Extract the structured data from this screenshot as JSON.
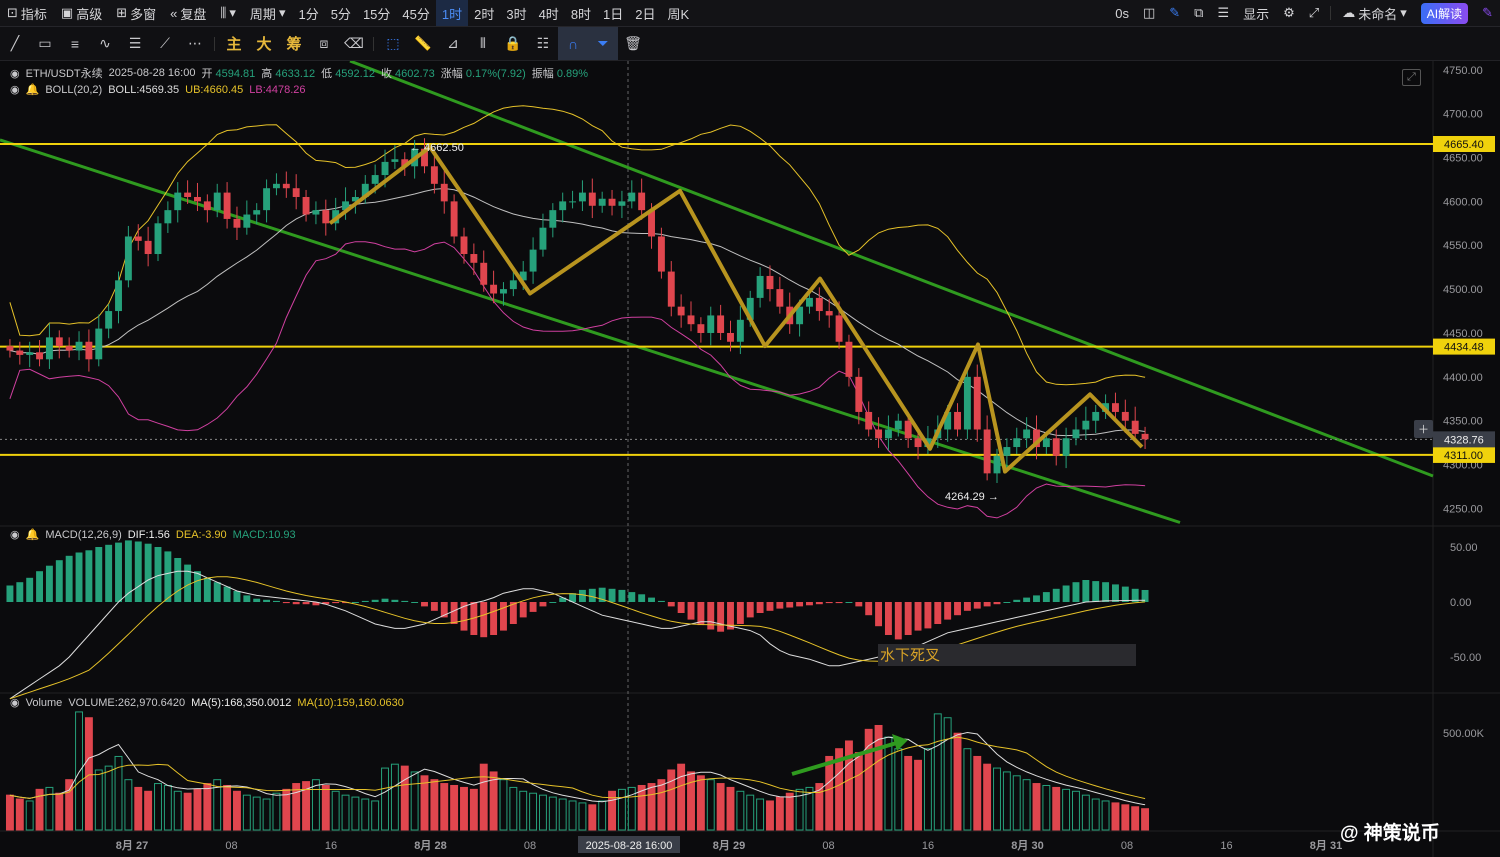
{
  "topbar": {
    "indicators": "指标",
    "advanced": "高级",
    "multi_window": "多窗",
    "replay": "复盘",
    "period": "周期",
    "timeframes": [
      "1分",
      "5分",
      "15分",
      "45分",
      "1时",
      "2时",
      "3时",
      "4时",
      "8时",
      "1日",
      "2日",
      "周K"
    ],
    "active_timeframe": "1时",
    "countdown": "0s",
    "display": "显示",
    "unnamed": "未命名",
    "ai_explain": "AI解读"
  },
  "drawing_tools": {
    "main": "主",
    "big": "大",
    "chip": "筹"
  },
  "price_legend": {
    "symbol": "ETH/USDT永续",
    "datetime": "2025-08-28 16:00",
    "open_label": "开",
    "open": "4594.81",
    "high_label": "高",
    "high": "4633.12",
    "low_label": "低",
    "low": "4592.12",
    "close_label": "收",
    "close": "4602.73",
    "change_label": "涨幅",
    "change": "0.17%(7.92)",
    "amplitude_label": "振幅",
    "amplitude": "0.89%"
  },
  "boll_legend": {
    "name": "BOLL(20,2)",
    "boll": "BOLL:4569.35",
    "ub": "UB:4660.45",
    "lb": "LB:4478.26"
  },
  "macd_legend": {
    "name": "MACD(12,26,9)",
    "dif": "DIF:1.56",
    "dea": "DEA:-3.90",
    "macd": "MACD:10.93"
  },
  "volume_legend": {
    "name": "Volume",
    "volume": "VOLUME:262,970.6420",
    "ma5": "MA(5):168,350.0012",
    "ma10": "MA(10):159,160.0630"
  },
  "annotations": {
    "high_marker": "4662.50",
    "low_marker": "4264.29",
    "macd_note": "水下死叉",
    "crosshair_time": "2025-08-28 16:00"
  },
  "price_tags": {
    "resistance_top": "4665.40",
    "resistance_mid": "4434.48",
    "current": "4328.76",
    "support": "4311.00"
  },
  "price_axis_labels": [
    "4750.00",
    "4700.00",
    "4650.00",
    "4600.00",
    "4550.00",
    "4500.00",
    "4450.00",
    "4400.00",
    "4350.00",
    "4300.00",
    "4250.00"
  ],
  "macd_axis_labels": [
    "50.00",
    "0.00",
    "-50.00"
  ],
  "volume_axis_labels": [
    "500.00K"
  ],
  "time_axis_labels": [
    "8月 27",
    "08",
    "16",
    "8月 28",
    "08",
    "16",
    "8月 29",
    "08",
    "16",
    "8月 30",
    "08",
    "16",
    "8月 31"
  ],
  "watermark": "@ 神策说币",
  "colors": {
    "up": "#26a17b",
    "down": "#e0464e",
    "level_line": "#f0d20c",
    "channel": "#2f9a1f",
    "zigzag": "#b8941f",
    "boll_mid": "#c0c0c0",
    "boll_up": "#e6c229",
    "boll_low": "#d040a0",
    "accent": "#3b7ef5"
  },
  "chart_data": {
    "type": "candlestick",
    "symbol": "ETH/USDT",
    "ylim": [
      4230,
      4760
    ],
    "levels": [
      4665.4,
      4434.48,
      4311.0
    ],
    "current_price": 4328.76,
    "closes": [
      4430,
      4425,
      4428,
      4420,
      4445,
      4435,
      4430,
      4440,
      4420,
      4455,
      4475,
      4510,
      4560,
      4555,
      4540,
      4575,
      4590,
      4610,
      4605,
      4600,
      4590,
      4610,
      4580,
      4570,
      4585,
      4590,
      4615,
      4620,
      4615,
      4605,
      4585,
      4590,
      4575,
      4590,
      4600,
      4605,
      4620,
      4630,
      4645,
      4648,
      4640,
      4660,
      4640,
      4620,
      4600,
      4560,
      4540,
      4530,
      4505,
      4495,
      4500,
      4510,
      4520,
      4545,
      4570,
      4590,
      4600,
      4600,
      4610,
      4595,
      4603,
      4595,
      4600,
      4610,
      4590,
      4560,
      4520,
      4480,
      4470,
      4460,
      4450,
      4470,
      4450,
      4440,
      4465,
      4490,
      4515,
      4500,
      4480,
      4460,
      4480,
      4490,
      4475,
      4470,
      4440,
      4400,
      4360,
      4340,
      4330,
      4340,
      4350,
      4330,
      4320,
      4330,
      4340,
      4360,
      4340,
      4400,
      4340,
      4290,
      4310,
      4320,
      4330,
      4340,
      4320,
      4330,
      4310,
      4330,
      4340,
      4350,
      4360,
      4370,
      4360,
      4350,
      4335,
      4328.76
    ],
    "macd_hist": [
      15,
      18,
      22,
      28,
      33,
      38,
      42,
      45,
      47,
      50,
      52,
      54,
      56,
      55,
      53,
      50,
      46,
      40,
      34,
      28,
      22,
      18,
      14,
      10,
      6,
      3,
      2,
      1,
      -1,
      -2,
      -2,
      -3,
      -2,
      -1,
      -1,
      0,
      1,
      2,
      3,
      2,
      1,
      0,
      -4,
      -8,
      -14,
      -20,
      -26,
      -30,
      -32,
      -30,
      -26,
      -20,
      -14,
      -9,
      -4,
      0,
      4,
      8,
      11,
      12,
      13,
      12,
      11,
      9,
      7,
      4,
      1,
      -4,
      -10,
      -16,
      -21,
      -25,
      -27,
      -25,
      -20,
      -14,
      -10,
      -8,
      -6,
      -5,
      -4,
      -3,
      -2,
      -1,
      -1,
      0,
      -4,
      -12,
      -22,
      -30,
      -34,
      -30,
      -26,
      -24,
      -20,
      -16,
      -12,
      -8,
      -6,
      -4,
      -2,
      0,
      2,
      4,
      6,
      9,
      12,
      15,
      18,
      20,
      19,
      18,
      16,
      14,
      12,
      10.93
    ],
    "dif": [
      -88,
      -82,
      -76,
      -70,
      -64,
      -58,
      -50,
      -40,
      -30,
      -20,
      -10,
      0,
      8,
      14,
      20,
      24,
      26,
      28,
      28,
      26,
      22,
      18,
      14,
      10,
      8,
      6,
      5,
      4,
      3,
      2,
      1,
      0,
      -2,
      -5,
      -8,
      -12,
      -16,
      -20,
      -22,
      -24,
      -24,
      -22,
      -20,
      -16,
      -12,
      -8,
      -4,
      -1,
      1,
      4,
      8,
      10,
      12,
      12,
      10,
      8,
      4,
      0,
      -4,
      -8,
      -12,
      -14,
      -16,
      -18,
      -20,
      -22,
      -24,
      -24,
      -22,
      -20,
      -18,
      -18,
      -20,
      -22,
      -24,
      -26,
      -30,
      -38,
      -44,
      -48,
      -50,
      -52,
      -55,
      -58,
      -58,
      -56,
      -54,
      -52,
      -50,
      -48,
      -46,
      -44,
      -40,
      -36,
      -32,
      -28,
      -26,
      -24,
      -22,
      -20,
      -18,
      -16,
      -14,
      -12,
      -10,
      -8,
      -6,
      -4,
      -2,
      0,
      0.5,
      1,
      1.2,
      1.4,
      1.5,
      1.56
    ],
    "volume": [
      180,
      160,
      150,
      210,
      220,
      190,
      260,
      610,
      580,
      310,
      330,
      380,
      260,
      220,
      200,
      240,
      230,
      200,
      190,
      210,
      240,
      260,
      230,
      200,
      180,
      170,
      160,
      190,
      210,
      240,
      250,
      260,
      230,
      200,
      180,
      170,
      160,
      150,
      320,
      340,
      330,
      300,
      280,
      260,
      240,
      230,
      220,
      210,
      340,
      300,
      260,
      220,
      200,
      190,
      180,
      170,
      160,
      150,
      140,
      130,
      150,
      200,
      210,
      220,
      230,
      240,
      260,
      310,
      340,
      300,
      280,
      260,
      240,
      220,
      200,
      180,
      160,
      150,
      170,
      190,
      210,
      220,
      240,
      380,
      420,
      460,
      400,
      520,
      540,
      480,
      420,
      380,
      360,
      420,
      600,
      580,
      500,
      420,
      380,
      340,
      320,
      300,
      280,
      260,
      240,
      230,
      220,
      210,
      200,
      180,
      160,
      150,
      140,
      130,
      120,
      110
    ],
    "vol_ylim": [
      0,
      620
    ]
  }
}
